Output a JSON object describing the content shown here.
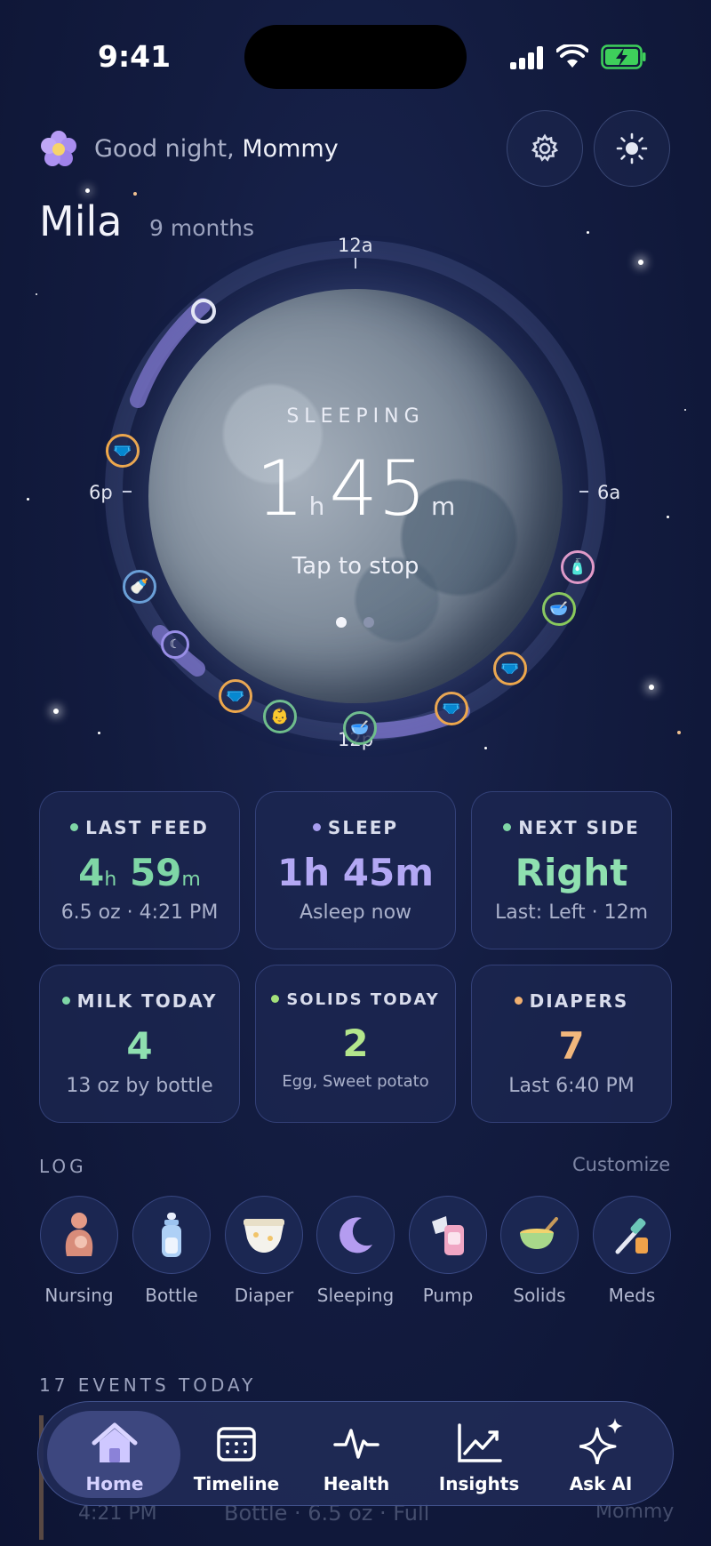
{
  "status_bar": {
    "time": "9:41"
  },
  "header": {
    "greeting": "Good night,",
    "user": "Mommy",
    "baby_name": "Mila",
    "baby_age": "9 months"
  },
  "clock": {
    "labels": {
      "top": "12a",
      "left": "6p",
      "right": "6a",
      "bottom": "12p"
    },
    "state": "SLEEPING",
    "hours": "1",
    "hours_unit": "h",
    "minutes": "45",
    "minutes_unit": "m",
    "action": "Tap to stop"
  },
  "cards": [
    {
      "title": "LAST FEED",
      "value_a": "4",
      "unit_a": "h",
      "value_b": "59",
      "unit_b": "m",
      "sub": "6.5 oz · 4:21 PM",
      "color": "#7fd6a6"
    },
    {
      "title": "SLEEP",
      "value": "1h 45m",
      "sub": "Asleep now",
      "color": "#a89ef0"
    },
    {
      "title": "NEXT SIDE",
      "value": "Right",
      "sub": "Last: Left · 12m",
      "color": "#7fd6a6"
    },
    {
      "title": "MILK TODAY",
      "value": "4",
      "sub": "13 oz by bottle",
      "color": "#7fd6a6"
    },
    {
      "title": "SOLIDS TODAY",
      "value": "2",
      "sub": "Egg, Sweet potato",
      "color": "#a3e07a"
    },
    {
      "title": "DIAPERS",
      "value": "7",
      "sub": "Last 6:40 PM",
      "color": "#f0b070"
    }
  ],
  "log": {
    "title": "LOG",
    "customize": "Customize",
    "items": [
      {
        "label": "Nursing",
        "icon": "nursing-icon"
      },
      {
        "label": "Bottle",
        "icon": "bottle-icon"
      },
      {
        "label": "Diaper",
        "icon": "diaper-icon"
      },
      {
        "label": "Sleeping",
        "icon": "moon-icon"
      },
      {
        "label": "Pump",
        "icon": "pump-icon"
      },
      {
        "label": "Solids",
        "icon": "bowl-icon"
      },
      {
        "label": "Meds",
        "icon": "dropper-icon"
      }
    ]
  },
  "events": {
    "title": "17 EVENTS TODAY",
    "row_time": "4:21 PM",
    "row_text": "Bottle · 6.5 oz · Full",
    "row_by": "Mommy"
  },
  "nav": {
    "items": [
      "Home",
      "Timeline",
      "Health",
      "Insights",
      "Ask AI"
    ],
    "active": "Home"
  }
}
